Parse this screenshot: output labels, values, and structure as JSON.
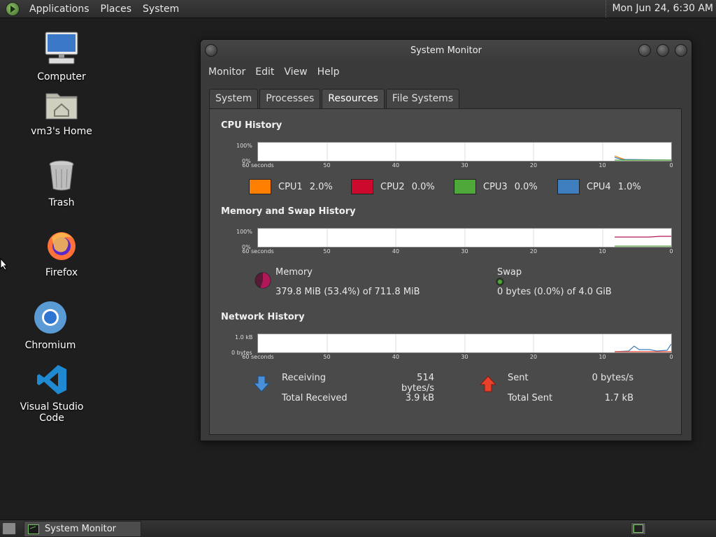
{
  "top_panel": {
    "menus": [
      "Applications",
      "Places",
      "System"
    ],
    "clock": "Mon Jun 24,  6:30 AM"
  },
  "desktop_icons": [
    {
      "label": "Computer",
      "icon": "computer-icon"
    },
    {
      "label": "vm3's Home",
      "icon": "home-folder-icon"
    },
    {
      "label": "Trash",
      "icon": "trash-icon"
    },
    {
      "label": "Firefox",
      "icon": "firefox-icon"
    },
    {
      "label": "Chromium",
      "icon": "chromium-icon"
    },
    {
      "label": "Visual Studio Code",
      "icon": "vscode-icon"
    }
  ],
  "window": {
    "title": "System Monitor",
    "menus": [
      "Monitor",
      "Edit",
      "View",
      "Help"
    ],
    "tabs": [
      "System",
      "Processes",
      "Resources",
      "File Systems"
    ],
    "active_tab": "Resources"
  },
  "resources": {
    "cpu": {
      "title": "CPU History",
      "y_top": "100%",
      "y_bottom": "0%",
      "x_ticks": [
        "60 seconds",
        "50",
        "40",
        "30",
        "20",
        "10",
        "0"
      ],
      "legend": [
        {
          "name": "CPU1",
          "value": "2.0%",
          "color": "#ff7f00"
        },
        {
          "name": "CPU2",
          "value": "0.0%",
          "color": "#cc0a2e"
        },
        {
          "name": "CPU3",
          "value": "0.0%",
          "color": "#4ea83a"
        },
        {
          "name": "CPU4",
          "value": "1.0%",
          "color": "#3f7fbf"
        }
      ]
    },
    "memory": {
      "title": "Memory and Swap History",
      "y_top": "100%",
      "y_bottom": "0%",
      "x_ticks": [
        "60 seconds",
        "50",
        "40",
        "30",
        "20",
        "10",
        "0"
      ],
      "memory_label": "Memory",
      "memory_value": "379.8 MiB (53.4%) of 711.8 MiB",
      "memory_color": "#b0185a",
      "swap_label": "Swap",
      "swap_value": "0 bytes (0.0%) of 4.0 GiB",
      "swap_color": "#4ea83a"
    },
    "network": {
      "title": "Network History",
      "y_top": "1.0 kB",
      "y_bottom": "0 bytes",
      "x_ticks": [
        "60 seconds",
        "50",
        "40",
        "30",
        "20",
        "10",
        "0"
      ],
      "receiving_label": "Receiving",
      "receiving_value": "514 bytes/s",
      "total_received_label": "Total Received",
      "total_received_value": "3.9 kB",
      "sent_label": "Sent",
      "sent_value": "0 bytes/s",
      "total_sent_label": "Total Sent",
      "total_sent_value": "1.7 kB"
    }
  },
  "bottom_panel": {
    "task": "System Monitor"
  }
}
